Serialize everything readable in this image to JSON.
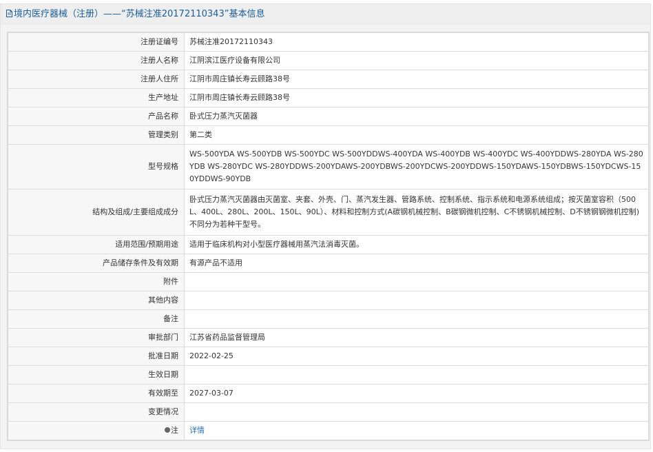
{
  "header": {
    "title": "境内医疗器械（注册）——“苏械注准20172110343”基本信息"
  },
  "rows": [
    {
      "label": "注册证编号",
      "value": "苏械注准20172110343"
    },
    {
      "label": "注册人名称",
      "value": "江阴滨江医疗设备有限公司"
    },
    {
      "label": "注册人住所",
      "value": "江阴市周庄镇长寿云顾路38号"
    },
    {
      "label": "生产地址",
      "value": "江阴市周庄镇长寿云顾路38号"
    },
    {
      "label": "产品名称",
      "value": "卧式压力蒸汽灭菌器"
    },
    {
      "label": "管理类别",
      "value": "第二类"
    },
    {
      "label": "型号规格",
      "value": "WS-500YDA WS-500YDB WS-500YDC WS-500YDDWS-400YDA WS-400YDB WS-400YDC WS-400YDDWS-280YDA WS-280YDB WS-280YDC WS-280YDDWS-200YDAWS-200YDBWS-200YDCWS-200YDDWS-150YDAWS-150YDBWS-150YDCWS-150YDDWS-90YDB"
    },
    {
      "label": "结构及组成/主要组成成分",
      "value": "卧式压力蒸汽灭菌器由灭菌室、夹套、外壳、门、蒸汽发生器、管路系统、控制系统、指示系统和电源系统组成；按灭菌室容积（500L、400L、280L、200L、150L、90L）、材料和控制方式(A碳钢机械控制、B碳钢微机控制、C不锈钢机械控制、D不锈钢钢微机控制)不同分为若种干型号。"
    },
    {
      "label": "适用范围/预期用途",
      "value": "适用于临床机构对小型医疗器械用蒸汽法消毒灭菌。"
    },
    {
      "label": "产品储存条件及有效期",
      "value": "有源产品不适用"
    },
    {
      "label": "附件",
      "value": ""
    },
    {
      "label": "其他内容",
      "value": ""
    },
    {
      "label": "备注",
      "value": ""
    },
    {
      "label": "审批部门",
      "value": "江苏省药品监督管理局"
    },
    {
      "label": "批准日期",
      "value": "2022-02-25"
    },
    {
      "label": "生效日期",
      "value": ""
    },
    {
      "label": "有效期至",
      "value": "2027-03-07"
    },
    {
      "label": "变更情况",
      "value": ""
    }
  ],
  "note": {
    "label": "注",
    "link": "详情",
    "icon": "pin-icon"
  }
}
